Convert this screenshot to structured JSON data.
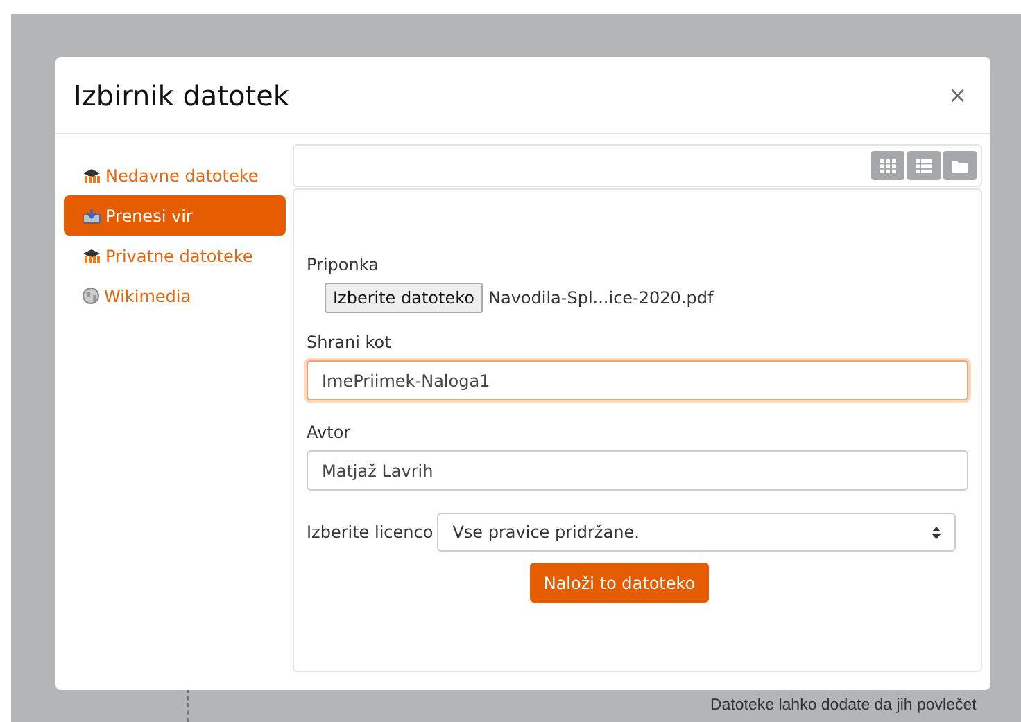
{
  "background": {
    "hint": "Datoteke lahko dodate da jih povlečet"
  },
  "dialog": {
    "title": "Izbirnik datotek",
    "close": "×"
  },
  "sidebar": {
    "items": [
      {
        "label": "Nedavne datoteke",
        "kind": "cap",
        "selected": false
      },
      {
        "label": "Prenesi vir",
        "kind": "upload",
        "selected": true
      },
      {
        "label": "Privatne datoteke",
        "kind": "cap",
        "selected": false
      },
      {
        "label": "Wikimedia",
        "kind": "globe",
        "selected": false
      }
    ]
  },
  "view_buttons": [
    {
      "kind": "grid"
    },
    {
      "kind": "list"
    },
    {
      "kind": "folder"
    }
  ],
  "form": {
    "attachment": {
      "label": "Priponka",
      "button": "Izberite datoteko",
      "filename": "Navodila-Spl...ice-2020.pdf"
    },
    "save_as": {
      "label": "Shrani kot",
      "value": "ImePriimek-Naloga1",
      "focused": true
    },
    "author": {
      "label": "Avtor",
      "value": "Matjaž Lavrih",
      "focused": false
    },
    "license": {
      "label": "Izberite licenco",
      "value": "Vse pravice pridržane."
    },
    "submit": "Naloži to datoteko"
  }
}
